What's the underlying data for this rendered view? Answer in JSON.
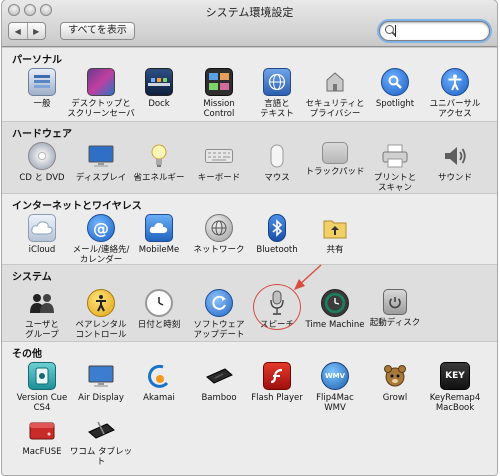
{
  "window": {
    "title": "システム環境設定",
    "show_all_label": "すべてを表示",
    "search_value": "",
    "nav_back": "◀",
    "nav_forward": "▶"
  },
  "sections": [
    {
      "header": "パーソナル",
      "items": [
        {
          "label": "一般",
          "icon": "general-icon"
        },
        {
          "label": "デスクトップと\nスクリーンセーバ",
          "icon": "desktop-icon"
        },
        {
          "label": "Dock",
          "icon": "dock-icon"
        },
        {
          "label": "Mission\nControl",
          "icon": "mission-control-icon"
        },
        {
          "label": "言語と\nテキスト",
          "icon": "language-icon"
        },
        {
          "label": "セキュリティと\nプライバシー",
          "icon": "security-icon"
        },
        {
          "label": "Spotlight",
          "icon": "spotlight-icon"
        },
        {
          "label": "ユニバーサル\nアクセス",
          "icon": "universal-access-icon"
        }
      ]
    },
    {
      "header": "ハードウェア",
      "items": [
        {
          "label": "CD と DVD",
          "icon": "cd-icon"
        },
        {
          "label": "ディスプレイ",
          "icon": "display-icon"
        },
        {
          "label": "省エネルギー",
          "icon": "energy-icon"
        },
        {
          "label": "キーボード",
          "icon": "keyboard-icon"
        },
        {
          "label": "マウス",
          "icon": "mouse-icon"
        },
        {
          "label": "トラックパッド",
          "icon": "trackpad-icon"
        },
        {
          "label": "プリントと\nスキャン",
          "icon": "printer-icon"
        },
        {
          "label": "サウンド",
          "icon": "sound-icon"
        }
      ]
    },
    {
      "header": "インターネットとワイヤレス",
      "items": [
        {
          "label": "iCloud",
          "icon": "icloud-icon"
        },
        {
          "label": "メール/連絡先/\nカレンダー",
          "icon": "mail-icon"
        },
        {
          "label": "MobileMe",
          "icon": "mobileme-icon"
        },
        {
          "label": "ネットワーク",
          "icon": "network-icon"
        },
        {
          "label": "Bluetooth",
          "icon": "bluetooth-icon"
        },
        {
          "label": "共有",
          "icon": "sharing-icon"
        }
      ]
    },
    {
      "header": "システム",
      "items": [
        {
          "label": "ユーザと\nグループ",
          "icon": "users-icon"
        },
        {
          "label": "ペアレンタル\nコントロール",
          "icon": "parental-icon"
        },
        {
          "label": "日付と時刻",
          "icon": "clock-icon"
        },
        {
          "label": "ソフトウェア\nアップデート",
          "icon": "update-icon"
        },
        {
          "label": "スピーチ",
          "icon": "microphone-icon"
        },
        {
          "label": "Time Machine",
          "icon": "time-machine-icon"
        },
        {
          "label": "起動ディスク",
          "icon": "startup-disk-icon"
        }
      ]
    },
    {
      "header": "その他",
      "items": [
        {
          "label": "Version Cue\nCS4",
          "icon": "version-cue-icon"
        },
        {
          "label": "Air Display",
          "icon": "air-display-icon"
        },
        {
          "label": "Akamai",
          "icon": "akamai-icon"
        },
        {
          "label": "Bamboo",
          "icon": "bamboo-icon"
        },
        {
          "label": "Flash Player",
          "icon": "flash-icon"
        },
        {
          "label": "Flip4Mac\nWMV",
          "icon": "flip4mac-icon"
        },
        {
          "label": "Growl",
          "icon": "growl-icon"
        },
        {
          "label": "KeyRemap4\nMacBook",
          "icon": "keyremap-icon"
        },
        {
          "label": "MacFUSE",
          "icon": "macfuse-icon"
        },
        {
          "label": "ワコム タブレット",
          "icon": "wacom-icon"
        }
      ]
    }
  ],
  "icon_glyphs": {
    "flip4mac": "WMV",
    "keyremap": "KEY"
  },
  "colors": {
    "highlight": "#d94c42"
  }
}
